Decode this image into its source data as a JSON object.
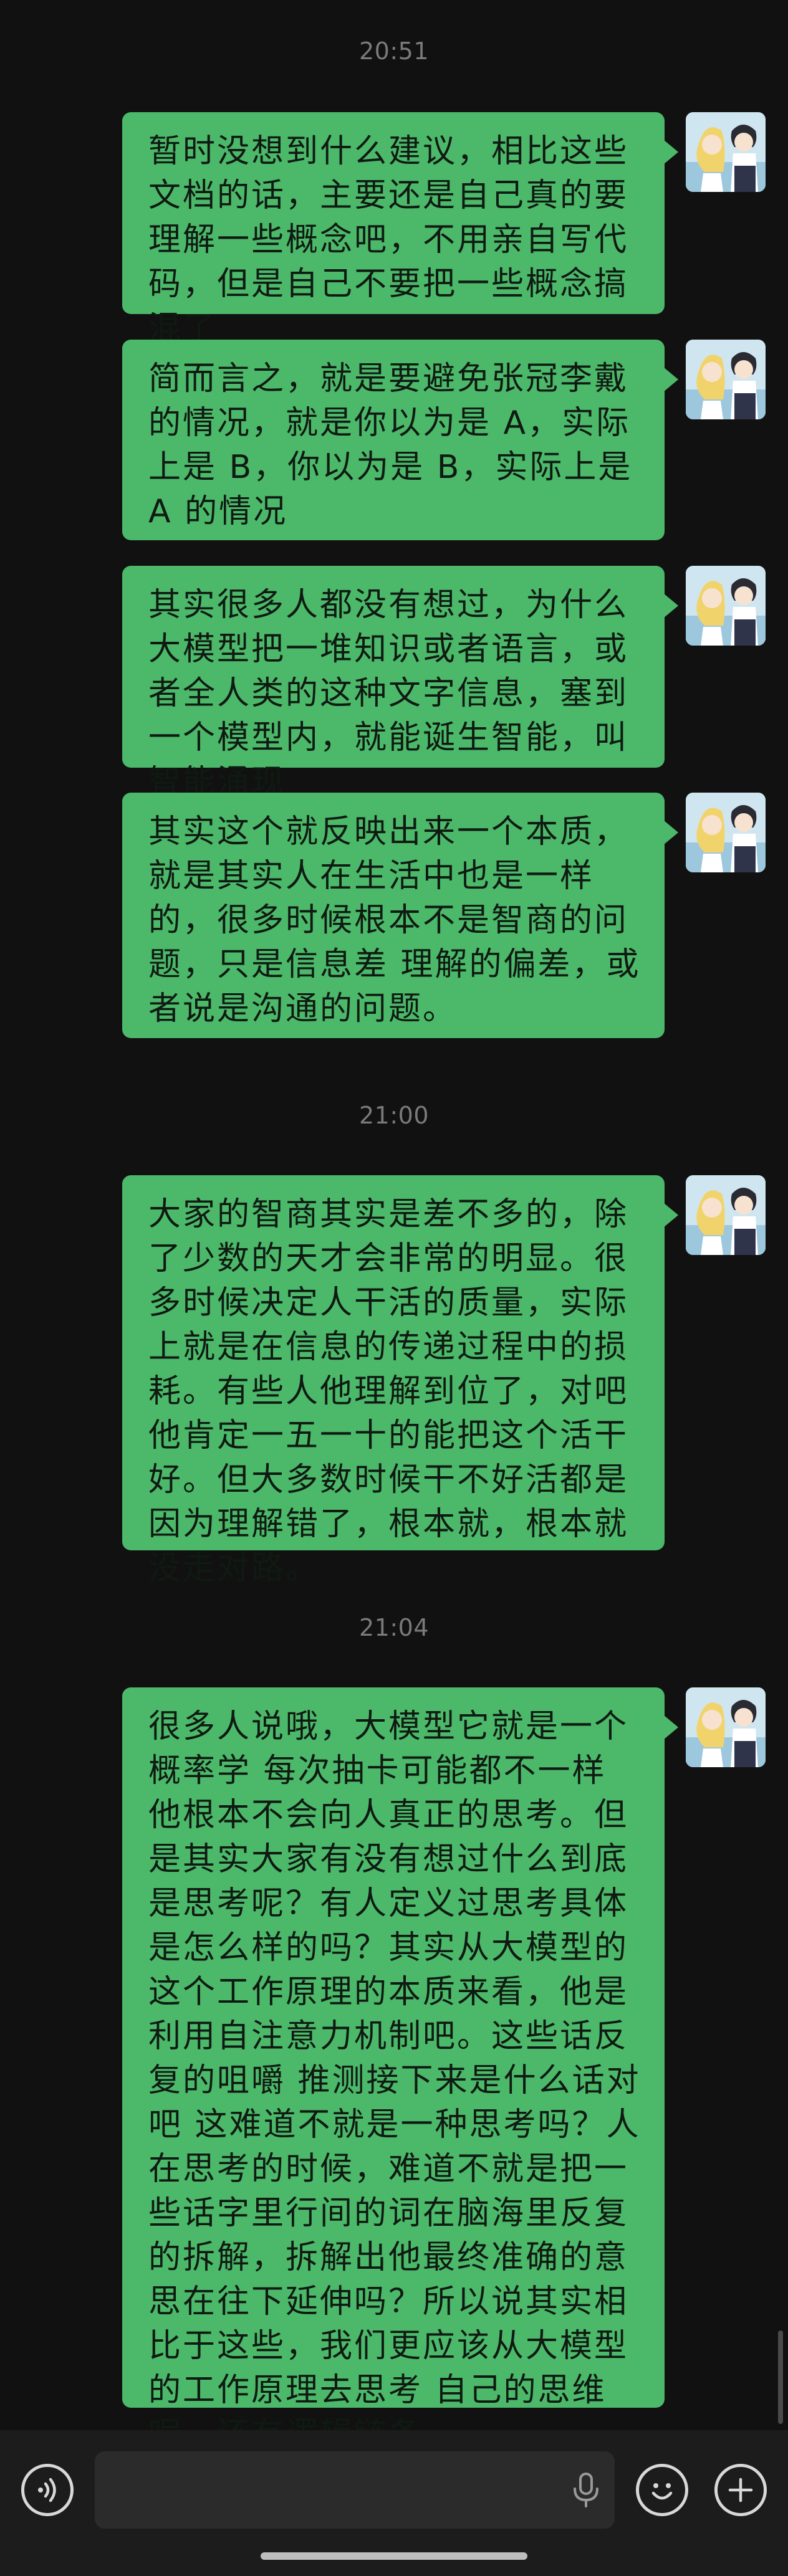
{
  "chat": {
    "accent_color": "#4cb86a",
    "background_color": "#111111",
    "timestamps": [
      "20:51",
      "21:00",
      "21:04"
    ],
    "messages": [
      {
        "text": "暂时没想到什么建议，相比这些文档的话，主要还是自己真的要理解一些概念吧，不用亲自写代码，但是自己不要把一些概念搞混了"
      },
      {
        "text": "简而言之，就是要避免张冠李戴的情况，就是你以为是 A，实际上是 B，你以为是 B，实际上是 A 的情况"
      },
      {
        "text": "其实很多人都没有想过，为什么大模型把一堆知识或者语言，或者全人类的这种文字信息，塞到一个模型内，就能诞生智能，叫智能涌现"
      },
      {
        "text": "其实这个就反映出来一个本质，就是其实人在生活中也是一样的，很多时候根本不是智商的问题，只是信息差 理解的偏差，或者说是沟通的问题。"
      },
      {
        "text": "大家的智商其实是差不多的，除了少数的天才会非常的明显。很多时候决定人干活的质量，实际上就是在信息的传递过程中的损耗。有些人他理解到位了，对吧他肯定一五一十的能把这个活干好。但大多数时候干不好活都是因为理解错了，根本就，根本就没走对路。"
      },
      {
        "text": "很多人说哦，大模型它就是一个概率学 每次抽卡可能都不一样 他根本不会向人真正的思考。但是其实大家有没有想过什么到底是思考呢？有人定义过思考具体是怎么样的吗？其实从大模型的这个工作原理的本质来看，他是利用自注意力机制吧。这些话反复的咀嚼 推测接下来是什么话对吧 这难道不就是一种思考吗？人在思考的时候，难道不就是把一些话字里行间的词在脑海里反复的拆解，拆解出他最终准确的意思在往下延伸吗？所以说其实相比于这些，我们更应该从大模型的工作原理去思考 自己的思维呢，还有逻辑链条。"
      }
    ]
  },
  "input_bar": {
    "value": "",
    "icons": {
      "voice_mode": "voice-wave-icon",
      "mic": "microphone-icon",
      "emoji": "emoji-icon",
      "more": "plus-icon"
    }
  }
}
